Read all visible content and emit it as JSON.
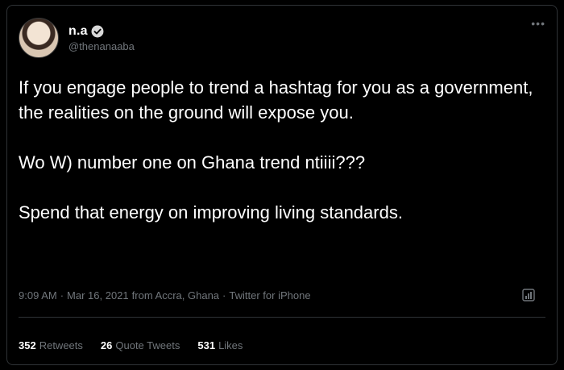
{
  "user": {
    "display_name": "n.a",
    "handle": "@thenanaaba"
  },
  "tweet": {
    "paragraph1": "If you engage people to trend a hashtag for you as a government, the realities on the ground will expose you.",
    "paragraph2": "Wo W) number one on Ghana trend ntiiii???",
    "paragraph3": "Spend that energy on improving living standards."
  },
  "meta": {
    "time": "9:09 AM",
    "date": "Mar 16, 2021",
    "location": "from Accra, Ghana",
    "source": "Twitter for iPhone"
  },
  "stats": {
    "retweets_count": "352",
    "retweets_label": "Retweets",
    "quote_count": "26",
    "quote_label": "Quote Tweets",
    "likes_count": "531",
    "likes_label": "Likes"
  },
  "colors": {
    "background": "#000000",
    "text": "#ffffff",
    "muted": "#71767b",
    "verified": "#d9d9d9"
  }
}
